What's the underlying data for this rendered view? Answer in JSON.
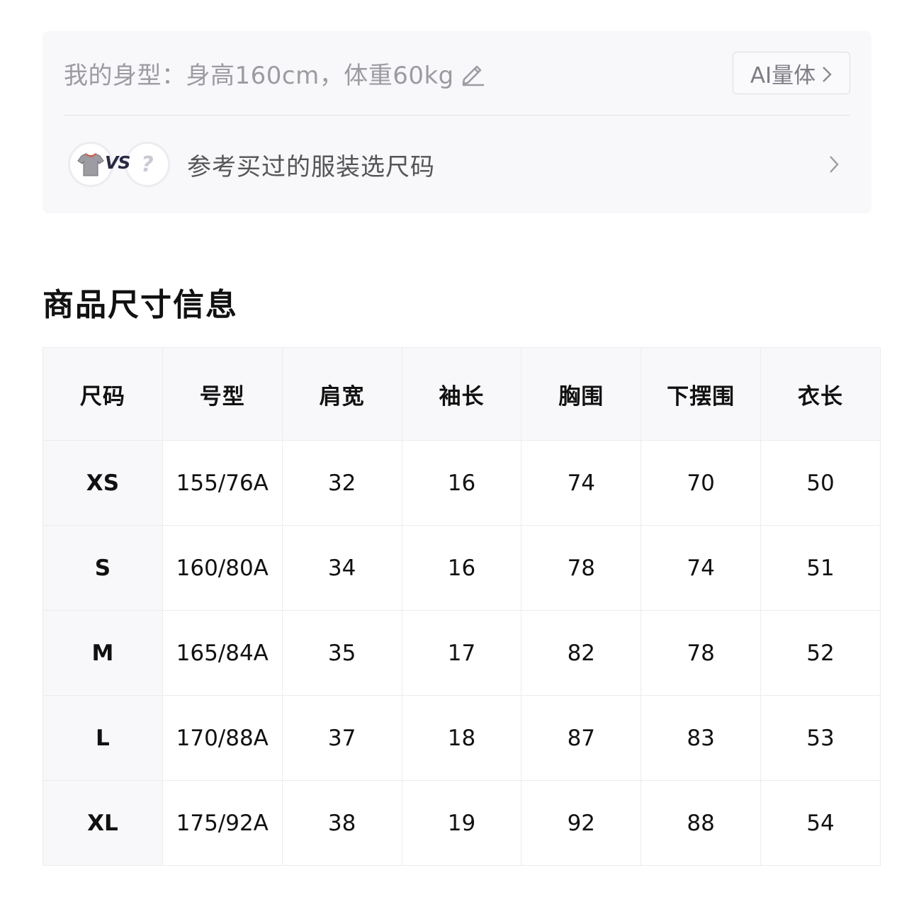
{
  "body_profile": {
    "text": "我的身型：身高160cm，体重60kg",
    "ai_button": "AI量体"
  },
  "reference": {
    "vs_label": "VS",
    "unknown_mark": "?",
    "text": "参考买过的服装选尺码"
  },
  "section": {
    "title": "商品尺寸信息"
  },
  "size_table": {
    "headers": [
      "尺码",
      "号型",
      "肩宽",
      "袖长",
      "胸围",
      "下摆围",
      "衣长"
    ],
    "rows": [
      [
        "XS",
        "155/76A",
        "32",
        "16",
        "74",
        "70",
        "50"
      ],
      [
        "S",
        "160/80A",
        "34",
        "16",
        "78",
        "74",
        "51"
      ],
      [
        "M",
        "165/84A",
        "35",
        "17",
        "82",
        "78",
        "52"
      ],
      [
        "L",
        "170/88A",
        "37",
        "18",
        "87",
        "83",
        "53"
      ],
      [
        "XL",
        "175/92A",
        "38",
        "19",
        "92",
        "88",
        "54"
      ]
    ]
  },
  "colors": {
    "card_bg": "#f8f8fa",
    "muted_text": "#9b9ba2",
    "border": "#ececf0"
  }
}
